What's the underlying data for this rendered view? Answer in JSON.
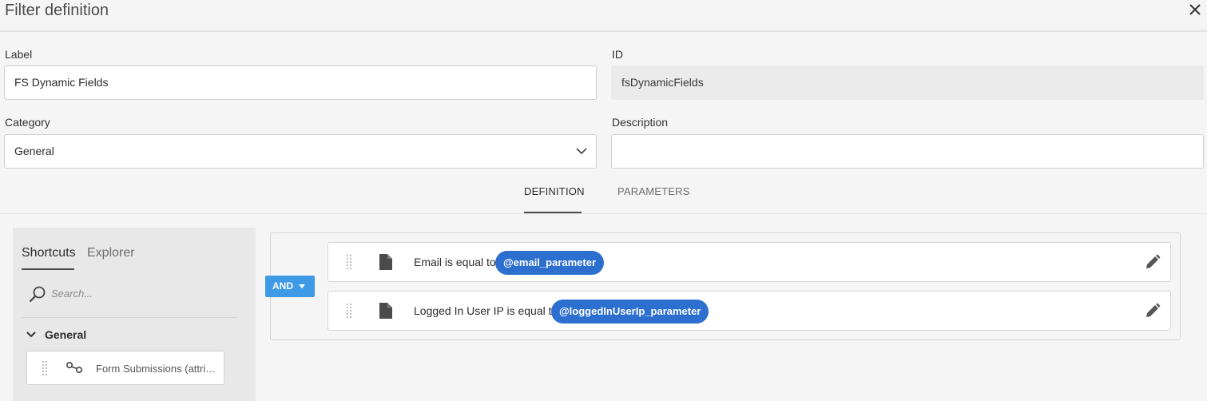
{
  "dialog": {
    "title": "Filter definition",
    "close_icon": "close-icon"
  },
  "form": {
    "label": {
      "label": "Label",
      "value": "FS Dynamic Fields"
    },
    "id": {
      "label": "ID",
      "value": "fsDynamicFields"
    },
    "category": {
      "label": "Category",
      "value": "General"
    },
    "description": {
      "label": "Description",
      "value": ""
    }
  },
  "tabs": [
    {
      "label": "DEFINITION",
      "active": true
    },
    {
      "label": "PARAMETERS",
      "active": false
    }
  ],
  "left_panel": {
    "tabs": [
      {
        "label": "Shortcuts",
        "active": true
      },
      {
        "label": "Explorer",
        "active": false
      }
    ],
    "search_placeholder": "Search...",
    "group": {
      "label": "General",
      "expanded": true
    },
    "items": [
      {
        "label": "Form Submissions (attri…",
        "icon": "link-node-icon"
      }
    ]
  },
  "rules": {
    "operator": "AND",
    "conditions": [
      {
        "text": "Email is equal to",
        "parameter": "@email_parameter"
      },
      {
        "text": "Logged In User IP is equal to",
        "parameter": "@loggedInUserIp_parameter"
      }
    ]
  },
  "colors": {
    "accent": "#3f9ae6",
    "pill": "#2c6fcf",
    "background": "#f5f5f5"
  }
}
